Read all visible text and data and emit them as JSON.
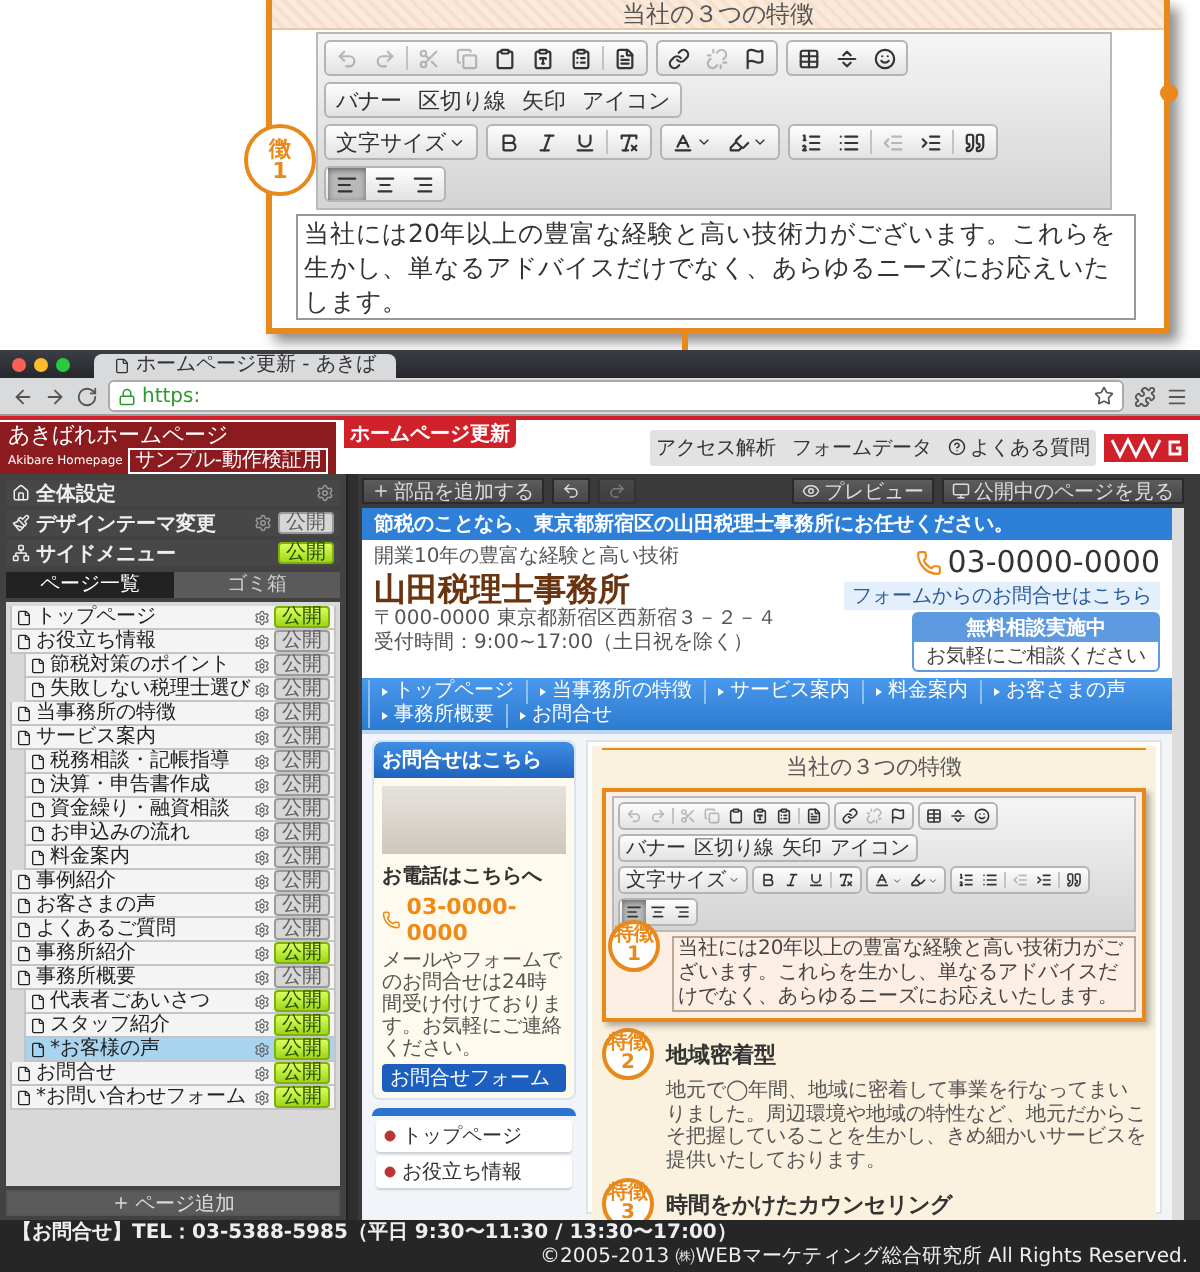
{
  "callout": {
    "heading": "当社の３つの特徴",
    "badge": {
      "label": "徴",
      "number": "1"
    },
    "toolbar": {
      "rows": [
        [
          {
            "sets": [
              [
                {
                  "kind": "undo",
                  "disabled": true
                },
                {
                  "kind": "redo",
                  "disabled": true
                }
              ],
              [
                {
                  "kind": "cut",
                  "disabled": true
                },
                {
                  "kind": "copy",
                  "disabled": true
                },
                {
                  "kind": "paste",
                  "disabled": false
                },
                {
                  "kind": "paste-text",
                  "disabled": false
                },
                {
                  "kind": "paste-word",
                  "disabled": false
                }
              ],
              [
                {
                  "kind": "template",
                  "disabled": false
                }
              ]
            ]
          },
          {
            "sets": [
              [
                {
                  "kind": "link",
                  "disabled": false
                },
                {
                  "kind": "unlink",
                  "disabled": true
                },
                {
                  "kind": "anchor",
                  "disabled": false
                }
              ]
            ]
          },
          {
            "sets": [
              [
                {
                  "kind": "table",
                  "disabled": false
                },
                {
                  "kind": "horizontal-rule",
                  "disabled": false
                },
                {
                  "kind": "emoji",
                  "disabled": false
                }
              ]
            ]
          }
        ],
        [
          {
            "sets": [
              [
                {
                  "kind": "text",
                  "label": "バナー",
                  "disabled": false
                },
                {
                  "kind": "text",
                  "label": "区切り線",
                  "disabled": false
                },
                {
                  "kind": "text",
                  "label": "矢印",
                  "disabled": false
                },
                {
                  "kind": "text",
                  "label": "アイコン",
                  "disabled": false
                }
              ]
            ]
          }
        ],
        [
          {
            "sets": [
              [
                {
                  "kind": "dropdown",
                  "label": "文字サイズ",
                  "disabled": false
                }
              ]
            ]
          },
          {
            "sets": [
              [
                {
                  "kind": "bold",
                  "disabled": false
                },
                {
                  "kind": "italic",
                  "disabled": false
                },
                {
                  "kind": "underline",
                  "disabled": false
                }
              ],
              [
                {
                  "kind": "remove-format",
                  "disabled": false
                }
              ]
            ]
          },
          {
            "sets": [
              [
                {
                  "kind": "text-color",
                  "disabled": false
                },
                {
                  "kind": "background-color",
                  "disabled": false
                }
              ]
            ]
          },
          {
            "sets": [
              [
                {
                  "kind": "numbered-list",
                  "disabled": false
                },
                {
                  "kind": "bullet-list",
                  "disabled": false
                }
              ],
              [
                {
                  "kind": "outdent",
                  "disabled": true
                },
                {
                  "kind": "indent",
                  "disabled": false
                }
              ],
              [
                {
                  "kind": "blockquote",
                  "disabled": false
                }
              ]
            ]
          }
        ],
        [
          {
            "sets": [
              [
                {
                  "kind": "align-left",
                  "disabled": false,
                  "selected": true
                },
                {
                  "kind": "align-center",
                  "disabled": false,
                  "selected": false
                },
                {
                  "kind": "align-right",
                  "disabled": false,
                  "selected": false
                }
              ]
            ]
          }
        ]
      ]
    },
    "paragraph": "当社には20年以上の豊富な経験と高い技術力がございます。これらを生かし、単なるアドバイスだけでなく、あらゆるニーズにお応えいたします。"
  },
  "browser": {
    "tab_title": "ホームページ更新 - あきば",
    "url_scheme": "https:"
  },
  "app_header": {
    "logo_title": "あきばれホームページ",
    "logo_subtitle": "Akibare Homepage",
    "logo_tag": "サンプル-動作検証用",
    "badge": "ホームページ更新",
    "links": [
      {
        "label": "アクセス解析",
        "kind": "plain"
      },
      {
        "label": "フォームデータ",
        "kind": "plain"
      },
      {
        "label": "よくある質問",
        "kind": "help"
      }
    ]
  },
  "sidebar": {
    "menu": [
      {
        "label": "全体設定",
        "kind": "home",
        "settings": true
      },
      {
        "label": "デザインテーマ変更",
        "kind": "theme",
        "settings": true,
        "publish": "公開",
        "published": false
      },
      {
        "label": "サイドメニュー",
        "kind": "sitemap",
        "settings": false,
        "publish": "公開",
        "published": true
      }
    ],
    "tabs": [
      {
        "label": "ページ一覧",
        "selected": true
      },
      {
        "label": "ゴミ箱",
        "selected": false
      }
    ],
    "pages": [
      {
        "label": "トップページ",
        "publish": "公開",
        "published": true,
        "selected": false
      },
      {
        "label": "お役立ち情報",
        "publish": "公開",
        "published": false,
        "selected": false,
        "children": [
          {
            "label": "節税対策のポイント",
            "publish": "公開",
            "published": false,
            "selected": false
          },
          {
            "label": "失敗しない税理士選び",
            "publish": "公開",
            "published": false,
            "selected": false
          }
        ]
      },
      {
        "label": "当事務所の特徴",
        "publish": "公開",
        "published": false,
        "selected": false
      },
      {
        "label": "サービス案内",
        "publish": "公開",
        "published": false,
        "selected": false,
        "children": [
          {
            "label": "税務相談・記帳指導",
            "publish": "公開",
            "published": false,
            "selected": false
          },
          {
            "label": "決算・申告書作成",
            "publish": "公開",
            "published": false,
            "selected": false
          },
          {
            "label": "資金繰り・融資相談",
            "publish": "公開",
            "published": false,
            "selected": false
          },
          {
            "label": "お申込みの流れ",
            "publish": "公開",
            "published": false,
            "selected": false
          },
          {
            "label": "料金案内",
            "publish": "公開",
            "published": false,
            "selected": false
          }
        ]
      },
      {
        "label": "事例紹介",
        "publish": "公開",
        "published": false,
        "selected": false
      },
      {
        "label": "お客さまの声",
        "publish": "公開",
        "published": false,
        "selected": false
      },
      {
        "label": "よくあるご質問",
        "publish": "公開",
        "published": false,
        "selected": false
      },
      {
        "label": "事務所紹介",
        "publish": "公開",
        "published": true,
        "selected": false
      },
      {
        "label": "事務所概要",
        "publish": "公開",
        "published": false,
        "selected": false,
        "children": [
          {
            "label": "代表者ごあいさつ",
            "publish": "公開",
            "published": true,
            "selected": false
          },
          {
            "label": "スタッフ紹介",
            "publish": "公開",
            "published": true,
            "selected": false
          },
          {
            "label": "*お客様の声",
            "publish": "公開",
            "published": true,
            "selected": true
          }
        ]
      },
      {
        "label": "お問合せ",
        "publish": "公開",
        "published": true,
        "selected": false
      },
      {
        "label": "*お問い合わせフォーム",
        "publish": "公開",
        "published": true,
        "selected": false
      }
    ],
    "add_button": "ページ追加"
  },
  "main_toolbar": {
    "add_button": "部品を追加する",
    "history": [
      {
        "kind": "undo",
        "disabled": false
      },
      {
        "kind": "redo",
        "disabled": true
      }
    ],
    "preview": "プレビュー",
    "view_live": "公開中のページを見る"
  },
  "site": {
    "topbar": "節税のことなら、東京都新宿区の山田税理士事務所にお任せください。",
    "tagline": "開業10年の豊富な経験と高い技術",
    "name": "山田税理士事務所",
    "address": "〒000-0000 東京都新宿区西新宿３－２－４",
    "hours": "受付時間：9:00~17:00（土日祝を除く）",
    "consult": {
      "title": "無料相談実施中",
      "subtitle": "お気軽にご相談ください"
    },
    "phone": "03-0000-0000",
    "form_link": "フォームからのお問合せはこちら",
    "nav": [
      "トップページ",
      "当事務所の特徴",
      "サービス案内",
      "料金案内",
      "お客さまの声",
      "事務所概要",
      "お問合せ"
    ],
    "contact": {
      "title": "お問合せはこちら",
      "phone_label": "お電話はこちらへ",
      "phone": "03-0000-0000",
      "text": "メールやフォームでのお問合せは24時間受け付けております。お気軽にご連絡ください。",
      "button": "お問合せフォーム"
    },
    "side_menu": [
      "トップページ",
      "お役立ち情報"
    ],
    "features": {
      "title": "当社の３つの特徴",
      "editor": {
        "badge": {
          "label": "特徴",
          "number": "1"
        },
        "toolbar": {
          "rows": [
            [
              {
                "sets": [
                  [
                    {
                      "kind": "undo",
                      "disabled": true
                    },
                    {
                      "kind": "redo",
                      "disabled": true
                    }
                  ],
                  [
                    {
                      "kind": "cut",
                      "disabled": true
                    },
                    {
                      "kind": "copy",
                      "disabled": true
                    },
                    {
                      "kind": "paste",
                      "disabled": false
                    },
                    {
                      "kind": "paste-text",
                      "disabled": false
                    },
                    {
                      "kind": "paste-word",
                      "disabled": false
                    }
                  ],
                  [
                    {
                      "kind": "template",
                      "disabled": false
                    }
                  ]
                ]
              },
              {
                "sets": [
                  [
                    {
                      "kind": "link",
                      "disabled": false
                    },
                    {
                      "kind": "unlink",
                      "disabled": true
                    },
                    {
                      "kind": "anchor",
                      "disabled": false
                    }
                  ]
                ]
              },
              {
                "sets": [
                  [
                    {
                      "kind": "table",
                      "disabled": false
                    },
                    {
                      "kind": "horizontal-rule",
                      "disabled": false
                    },
                    {
                      "kind": "emoji",
                      "disabled": false
                    }
                  ]
                ]
              }
            ],
            [
              {
                "sets": [
                  [
                    {
                      "kind": "text",
                      "label": "バナー",
                      "disabled": false
                    },
                    {
                      "kind": "text",
                      "label": "区切り線",
                      "disabled": false
                    },
                    {
                      "kind": "text",
                      "label": "矢印",
                      "disabled": false
                    },
                    {
                      "kind": "text",
                      "label": "アイコン",
                      "disabled": false
                    }
                  ]
                ]
              }
            ],
            [
              {
                "sets": [
                  [
                    {
                      "kind": "dropdown",
                      "label": "文字サイズ",
                      "disabled": false
                    }
                  ]
                ]
              },
              {
                "sets": [
                  [
                    {
                      "kind": "bold",
                      "disabled": false
                    },
                    {
                      "kind": "italic",
                      "disabled": false
                    },
                    {
                      "kind": "underline",
                      "disabled": false
                    }
                  ],
                  [
                    {
                      "kind": "remove-format",
                      "disabled": false
                    }
                  ]
                ]
              },
              {
                "sets": [
                  [
                    {
                      "kind": "text-color",
                      "disabled": false
                    },
                    {
                      "kind": "background-color",
                      "disabled": false
                    }
                  ]
                ]
              },
              {
                "sets": [
                  [
                    {
                      "kind": "numbered-list",
                      "disabled": false
                    },
                    {
                      "kind": "bullet-list",
                      "disabled": false
                    }
                  ],
                  [
                    {
                      "kind": "outdent",
                      "disabled": true
                    },
                    {
                      "kind": "indent",
                      "disabled": false
                    }
                  ],
                  [
                    {
                      "kind": "blockquote",
                      "disabled": false
                    }
                  ]
                ]
              }
            ],
            [
              {
                "sets": [
                  [
                    {
                      "kind": "align-left",
                      "disabled": false,
                      "selected": true
                    },
                    {
                      "kind": "align-center",
                      "disabled": false,
                      "selected": false
                    },
                    {
                      "kind": "align-right",
                      "disabled": false,
                      "selected": false
                    }
                  ]
                ]
              }
            ]
          ]
        },
        "paragraph": "当社には20年以上の豊富な経験と高い技術力がございます。これらを生かし、単なるアドバイスだけでなく、あらゆるニーズにお応えいたします。"
      },
      "items": [
        {
          "label": "特徴",
          "number": "2",
          "title": "地域密着型",
          "text": "地元で◯年間、地域に密着して事業を行なってまいりました。周辺環境や地域の特性など、地元だからこそ把握していることを生かし、きめ細かいサービスを提供いたしております。"
        },
        {
          "label": "特徴",
          "number": "3",
          "title": "時間をかけたカウンセリング"
        }
      ]
    }
  },
  "footer": {
    "contact": "【お問合せ】TEL：03-5388-5985（平日 9:30〜11:30 / 13:30〜17:00）",
    "copyright": "©2005-2013 ㈱WEBマーケティング総合研究所 All Rights Reserved."
  }
}
